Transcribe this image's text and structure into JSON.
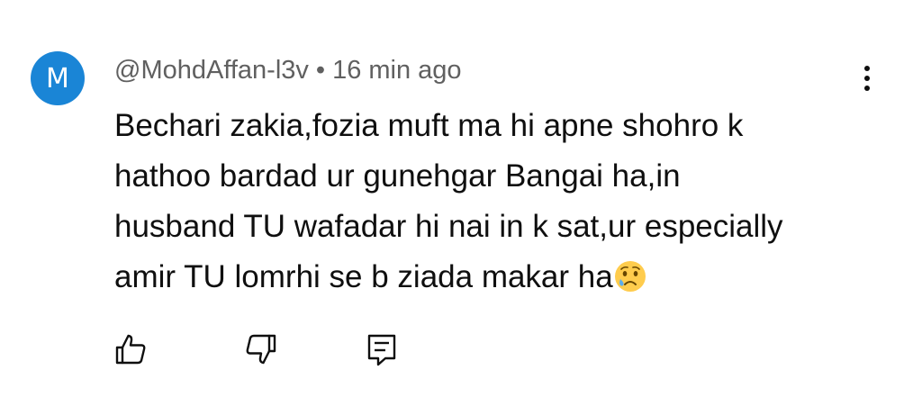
{
  "comment": {
    "avatar_letter": "M",
    "author": "@MohdAffan-l3v",
    "separator": "•",
    "time": "16 min ago",
    "text_lines": [
      "Bechari zakia,fozia muft ma hi apne shohro k",
      "hathoo bardad ur gunehgar Bangai ha,in",
      "husband TU wafadar hi nai in k sat,ur especially",
      "amir TU lomrhi se b ziada makar ha"
    ],
    "emoji": "crying-face"
  },
  "actions": {
    "like_icon": "thumbs-up-icon",
    "dislike_icon": "thumbs-down-icon",
    "reply_icon": "reply-comment-icon",
    "menu_icon": "more-vertical-icon"
  },
  "colors": {
    "avatar_bg": "#1a85d6",
    "meta_text": "#606060",
    "body_text": "#0f0f0f"
  }
}
